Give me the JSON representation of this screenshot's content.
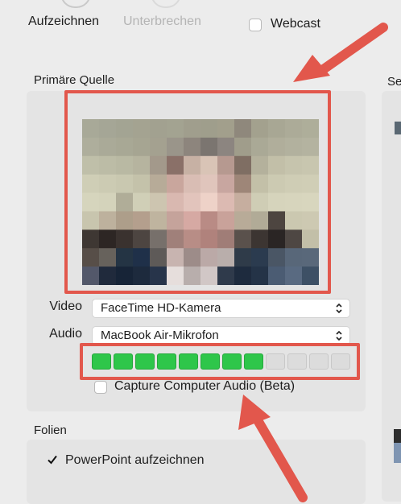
{
  "toolbar": {
    "record_label": "Aufzeichnen",
    "pause_label": "Unterbrechen",
    "webcast_label": "Webcast"
  },
  "primary_source": {
    "title": "Primäre Quelle",
    "video_label": "Video",
    "video_value": "FaceTime HD-Kamera",
    "audio_label": "Audio",
    "audio_value": "MacBook Air-Mikrofon",
    "audio_level": {
      "active_segments": 8,
      "total_segments": 12
    },
    "capture_audio_label": "Capture Computer Audio (Beta)"
  },
  "secondary_source": {
    "title_fragment": "Se"
  },
  "slides": {
    "title": "Folien",
    "powerpoint_label": "PowerPoint aufzeichnen",
    "powerpoint_checked": true
  },
  "colors": {
    "annotation": "#e2574c",
    "meter_active": "#2ec64a",
    "meter_inactive": "#dcdcdc"
  },
  "icons": {
    "select_chevron": "up-down-chevron-icon",
    "annotation_arrow": "arrow-icon"
  }
}
